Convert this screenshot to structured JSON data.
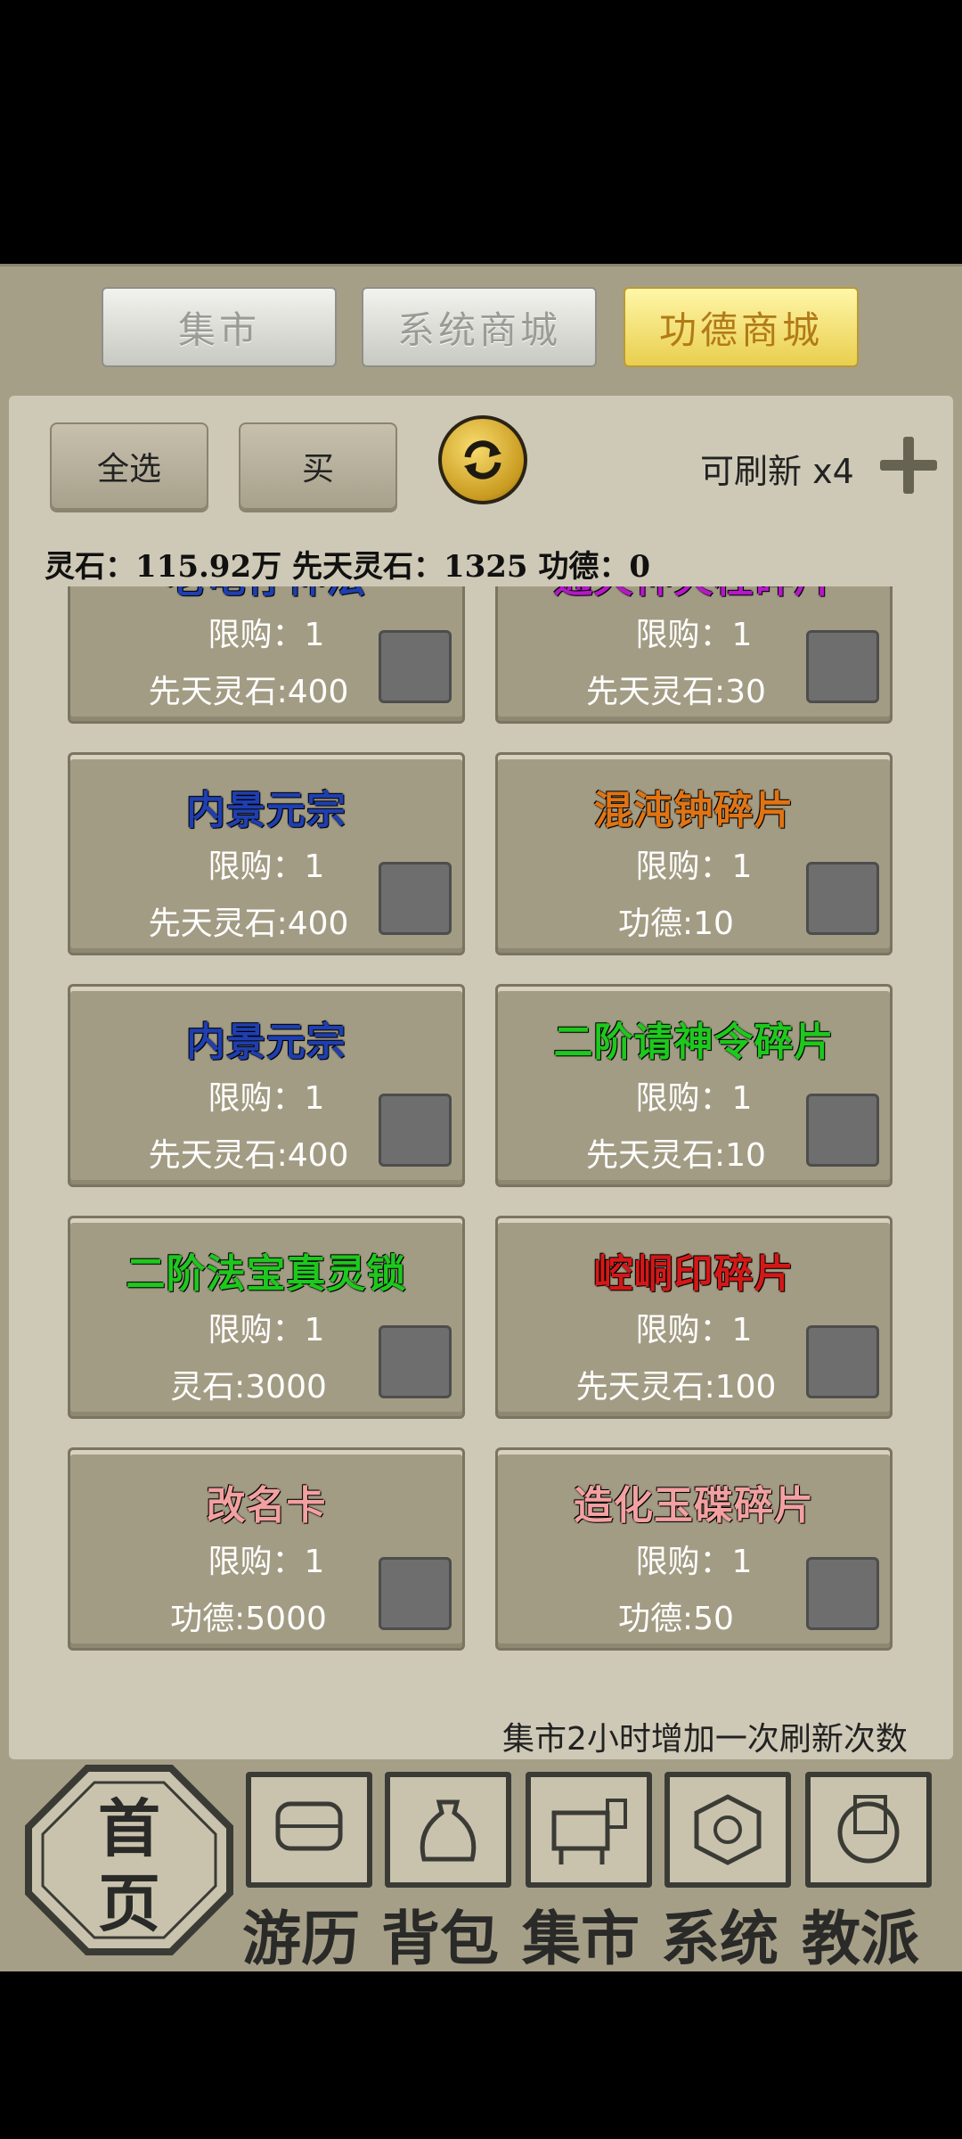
{
  "tabs": [
    {
      "label": "集市",
      "active": false
    },
    {
      "label": "系统商城",
      "active": false
    },
    {
      "label": "功德商城",
      "active": true
    }
  ],
  "toolbar": {
    "select_all": "全选",
    "buy": "买",
    "refresh_count": "可刷新 x4"
  },
  "currency": {
    "text": "灵石：115.92万 先天灵石：1325 功德：0"
  },
  "items": [
    {
      "name": "老龟存神法",
      "name_color": "#1f3fb0",
      "limit": "限购：1",
      "price": "先天灵石:400"
    },
    {
      "name": "通天神火柱碎片",
      "name_color": "#b418c8",
      "limit": "限购：1",
      "price": "先天灵石:30"
    },
    {
      "name": "内景元宗",
      "name_color": "#1f3fb0",
      "limit": "限购：1",
      "price": "先天灵石:400"
    },
    {
      "name": "混沌钟碎片",
      "name_color": "#e07414",
      "limit": "限购：1",
      "price": "功德:10"
    },
    {
      "name": "内景元宗",
      "name_color": "#1f3fb0",
      "limit": "限购：1",
      "price": "先天灵石:400"
    },
    {
      "name": "二阶请神令碎片",
      "name_color": "#1ec81e",
      "limit": "限购：1",
      "price": "先天灵石:10"
    },
    {
      "name": "二阶法宝真灵锁",
      "name_color": "#1ec81e",
      "limit": "限购：1",
      "price": "灵石:3000"
    },
    {
      "name": "崆峒印碎片",
      "name_color": "#d41818",
      "limit": "限购：1",
      "price": "先天灵石:100"
    },
    {
      "name": "改名卡",
      "name_color": "#f2a0a0",
      "limit": "限购：1",
      "price": "功德:5000"
    },
    {
      "name": "造化玉碟碎片",
      "name_color": "#f2a0a0",
      "limit": "限购：1",
      "price": "功德:50"
    }
  ],
  "note": "集市2小时增加一次刷新次数",
  "nav": {
    "home": [
      "首",
      "页"
    ],
    "items": [
      {
        "label": "游历",
        "icon": "chest-icon"
      },
      {
        "label": "背包",
        "icon": "bag-icon"
      },
      {
        "label": "集市",
        "icon": "stall-icon"
      },
      {
        "label": "系统",
        "icon": "system-seal-icon"
      },
      {
        "label": "教派",
        "icon": "sect-seal-icon"
      }
    ]
  }
}
